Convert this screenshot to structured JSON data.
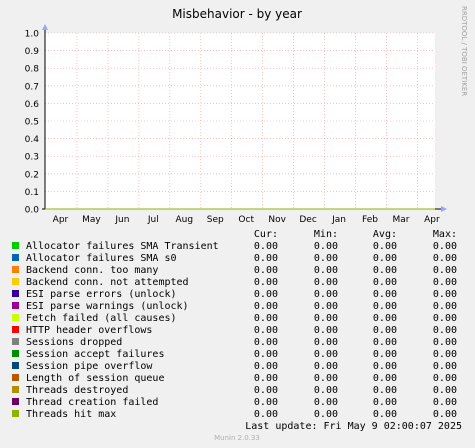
{
  "chart_data": {
    "type": "line",
    "title": "Misbehavior - by year",
    "watermark": "RRDTOOL / TOBI OETIKER",
    "footer": "Munin 2.0.33",
    "ylim": [
      0,
      1.0
    ],
    "y_ticks": [
      "0.0",
      "0.1",
      "0.2",
      "0.3",
      "0.4",
      "0.5",
      "0.6",
      "0.7",
      "0.8",
      "0.9",
      "1.0"
    ],
    "x_ticks": [
      "Apr",
      "May",
      "Jun",
      "Jul",
      "Aug",
      "Sep",
      "Oct",
      "Nov",
      "Dec",
      "Jan",
      "Feb",
      "Mar",
      "Apr"
    ],
    "grid": true,
    "legend_headers": [
      "Cur:",
      "Min:",
      "Avg:",
      "Max:"
    ],
    "series": [
      {
        "name": "Allocator failures SMA Transient",
        "color": "#00cc00",
        "cur": "0.00",
        "min": "0.00",
        "avg": "0.00",
        "max": "0.00"
      },
      {
        "name": "Allocator failures SMA s0",
        "color": "#0066b3",
        "cur": "0.00",
        "min": "0.00",
        "avg": "0.00",
        "max": "0.00"
      },
      {
        "name": "Backend conn. too many",
        "color": "#ff8000",
        "cur": "0.00",
        "min": "0.00",
        "avg": "0.00",
        "max": "0.00"
      },
      {
        "name": "Backend conn. not attempted",
        "color": "#ffcc00",
        "cur": "0.00",
        "min": "0.00",
        "avg": "0.00",
        "max": "0.00"
      },
      {
        "name": "ESI parse errors (unlock)",
        "color": "#330099",
        "cur": "0.00",
        "min": "0.00",
        "avg": "0.00",
        "max": "0.00"
      },
      {
        "name": "ESI parse warnings (unlock)",
        "color": "#990099",
        "cur": "0.00",
        "min": "0.00",
        "avg": "0.00",
        "max": "0.00"
      },
      {
        "name": "Fetch failed (all causes)",
        "color": "#ccff00",
        "cur": "0.00",
        "min": "0.00",
        "avg": "0.00",
        "max": "0.00"
      },
      {
        "name": "HTTP header overflows",
        "color": "#ff0000",
        "cur": "0.00",
        "min": "0.00",
        "avg": "0.00",
        "max": "0.00"
      },
      {
        "name": "Sessions dropped",
        "color": "#808080",
        "cur": "0.00",
        "min": "0.00",
        "avg": "0.00",
        "max": "0.00"
      },
      {
        "name": "Session accept failures",
        "color": "#008f00",
        "cur": "0.00",
        "min": "0.00",
        "avg": "0.00",
        "max": "0.00"
      },
      {
        "name": "Session pipe overflow",
        "color": "#00487d",
        "cur": "0.00",
        "min": "0.00",
        "avg": "0.00",
        "max": "0.00"
      },
      {
        "name": "Length of session queue",
        "color": "#b35a00",
        "cur": "0.00",
        "min": "0.00",
        "avg": "0.00",
        "max": "0.00"
      },
      {
        "name": "Threads destroyed",
        "color": "#b38f00",
        "cur": "0.00",
        "min": "0.00",
        "avg": "0.00",
        "max": "0.00"
      },
      {
        "name": "Thread creation failed",
        "color": "#6b006b",
        "cur": "0.00",
        "min": "0.00",
        "avg": "0.00",
        "max": "0.00"
      },
      {
        "name": "Threads hit max",
        "color": "#8fb300",
        "cur": "0.00",
        "min": "0.00",
        "avg": "0.00",
        "max": "0.00"
      }
    ],
    "last_update": "Last update:  Fri May  9 02:00:07 2025"
  }
}
